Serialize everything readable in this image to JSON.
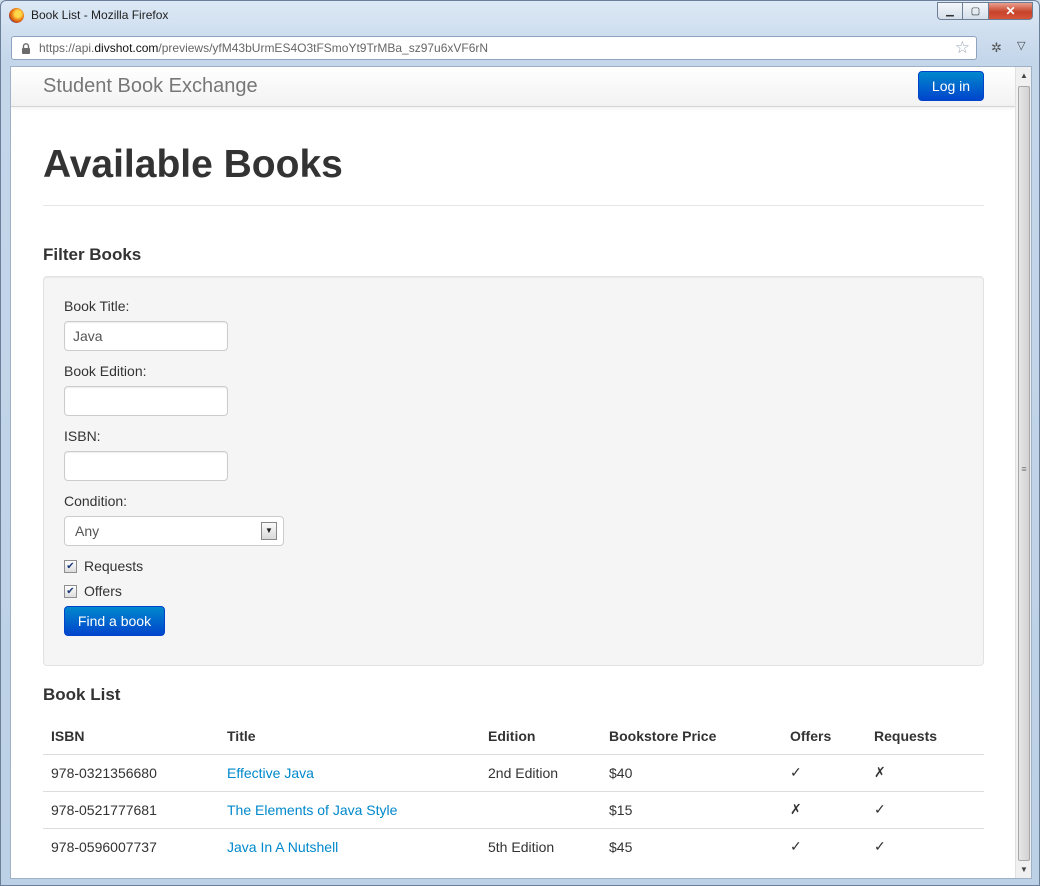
{
  "window": {
    "title": "Book List - Mozilla Firefox",
    "controls": {
      "minimize": "▁",
      "maximize": "▢",
      "close": "✕"
    }
  },
  "browser": {
    "url_prefix": "https://api.",
    "url_domain": "divshot.com",
    "url_path": "/previews/yfM43bUrmES4O3tFSmoYt9TrMBa_sz97u6xVF6rN",
    "icons": {
      "lock": "lock-icon",
      "bookmark": "star-icon",
      "addon": "addon-icon",
      "menu": "chevron-down-icon"
    }
  },
  "navbar": {
    "brand": "Student Book Exchange",
    "login_label": "Log in"
  },
  "page": {
    "title": "Available Books"
  },
  "filter": {
    "heading": "Filter Books",
    "title_label": "Book Title:",
    "title_value": "Java",
    "edition_label": "Book Edition:",
    "edition_value": "",
    "isbn_label": "ISBN:",
    "isbn_value": "",
    "condition_label": "Condition:",
    "condition_value": "Any",
    "requests_label": "Requests",
    "requests_checked": true,
    "offers_label": "Offers",
    "offers_checked": true,
    "submit_label": "Find a book"
  },
  "book_list": {
    "heading": "Book List",
    "columns": [
      "ISBN",
      "Title",
      "Edition",
      "Bookstore Price",
      "Offers",
      "Requests"
    ],
    "rows": [
      {
        "isbn": "978-0321356680",
        "title": "Effective Java",
        "edition": "2nd Edition",
        "price": "$40",
        "offers": "✓",
        "requests": "✗"
      },
      {
        "isbn": "978-0521777681",
        "title": "The Elements of Java Style",
        "edition": "",
        "price": "$15",
        "offers": "✗",
        "requests": "✓"
      },
      {
        "isbn": "978-0596007737",
        "title": "Java In A Nutshell",
        "edition": "5th Edition",
        "price": "$45",
        "offers": "✓",
        "requests": "✓"
      }
    ]
  },
  "colors": {
    "primary_button": "#0066cc",
    "link": "#0088cc",
    "well_background": "#f5f5f5"
  }
}
